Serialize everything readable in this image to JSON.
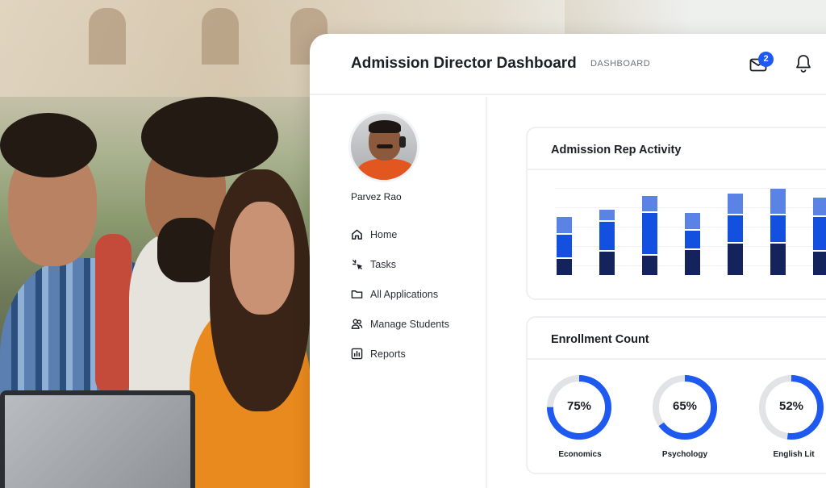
{
  "header": {
    "title": "Admission Director Dashboard",
    "breadcrumb": "DASHBOARD",
    "mail_badge": "2"
  },
  "profile": {
    "name": "Parvez Rao"
  },
  "sidebar": {
    "items": [
      {
        "label": "Home",
        "icon": "home-icon"
      },
      {
        "label": "Tasks",
        "icon": "tasks-icon"
      },
      {
        "label": "All Applications",
        "icon": "folder-icon"
      },
      {
        "label": "Manage Students",
        "icon": "users-icon"
      },
      {
        "label": "Reports",
        "icon": "chart-icon"
      }
    ]
  },
  "activity": {
    "title": "Admission Rep Activity"
  },
  "enrollment": {
    "title": "Enrollment Count",
    "items": [
      {
        "label": "Economics",
        "percent": 75,
        "percent_label": "75%"
      },
      {
        "label": "Psychology",
        "percent": 65,
        "percent_label": "65%"
      },
      {
        "label": "English Lit",
        "percent": 52,
        "percent_label": "52%"
      }
    ]
  },
  "chart_data": {
    "type": "bar",
    "title": "Admission Rep Activity",
    "stacked": true,
    "categories": [
      "",
      "",
      "",
      "",
      "",
      "",
      ""
    ],
    "series": [
      {
        "values": [
          20,
          28,
          24,
          30,
          38,
          38,
          28
        ]
      },
      {
        "values": [
          28,
          34,
          48,
          22,
          32,
          32,
          40
        ]
      },
      {
        "values": [
          20,
          14,
          20,
          20,
          24,
          30,
          22
        ]
      }
    ],
    "colors": [
      "#14235c",
      "#1450e0",
      "#5b83e6"
    ],
    "ylim": [
      0,
      110
    ],
    "grid": true,
    "legend": "none"
  },
  "colors": {
    "accent": "#1e5af0",
    "ring_track": "#e1e3e7"
  }
}
